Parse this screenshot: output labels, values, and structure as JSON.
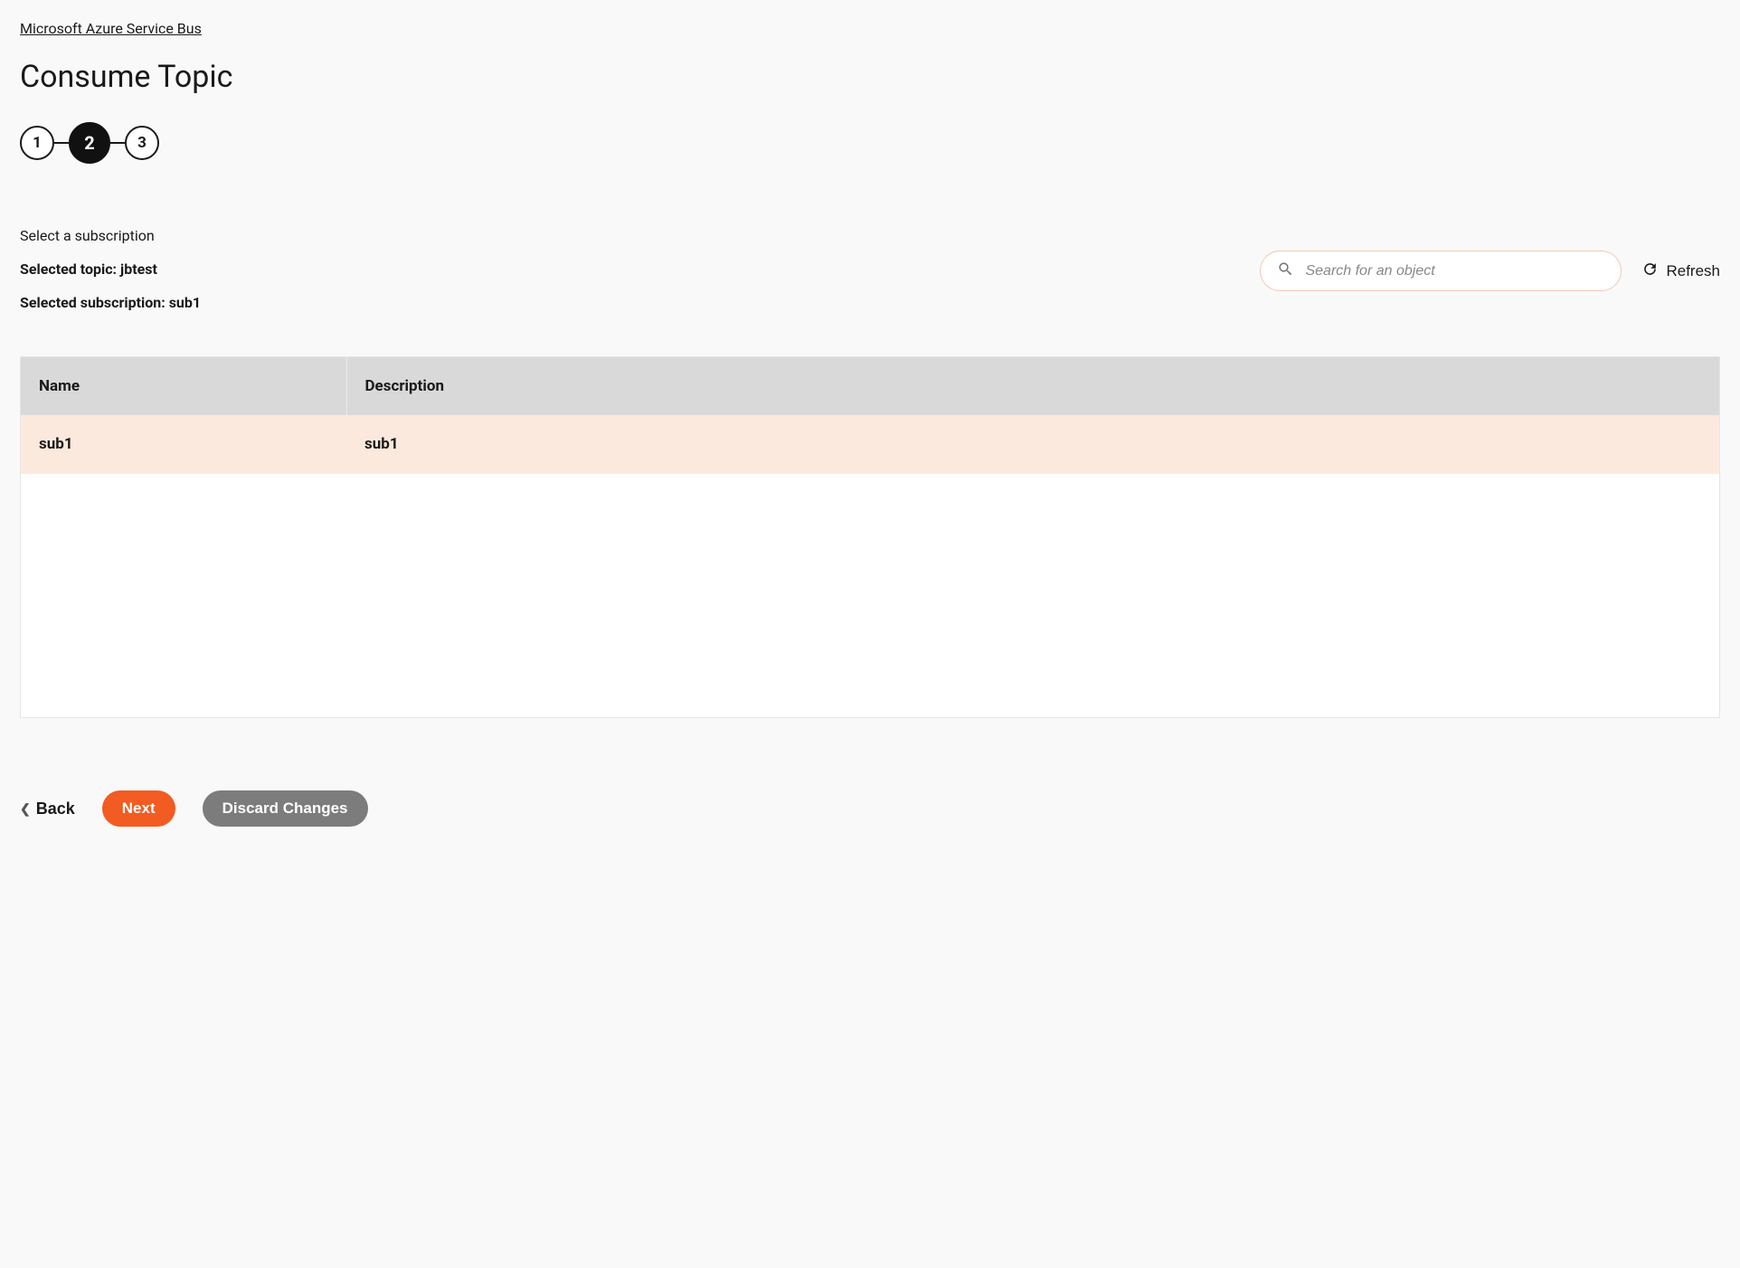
{
  "breadcrumb": {
    "label": "Microsoft Azure Service Bus"
  },
  "page": {
    "title": "Consume Topic"
  },
  "stepper": {
    "steps": [
      "1",
      "2",
      "3"
    ],
    "active_index": 1
  },
  "info": {
    "subtitle": "Select a subscription",
    "selected_topic_label": "Selected topic: jbtest",
    "selected_subscription_label": "Selected subscription: sub1"
  },
  "search": {
    "placeholder": "Search for an object"
  },
  "refresh": {
    "label": "Refresh"
  },
  "table": {
    "headers": {
      "name": "Name",
      "description": "Description"
    },
    "rows": [
      {
        "name": "sub1",
        "description": "sub1",
        "selected": true
      }
    ]
  },
  "footer": {
    "back": "Back",
    "next": "Next",
    "discard": "Discard Changes"
  },
  "colors": {
    "accent": "#f25b21",
    "step_active_bg": "#111111",
    "row_selected_bg": "#fce9de",
    "header_bg": "#d9d9d9",
    "discard_bg": "#7c7c7c",
    "search_border": "#f4c9b6"
  }
}
